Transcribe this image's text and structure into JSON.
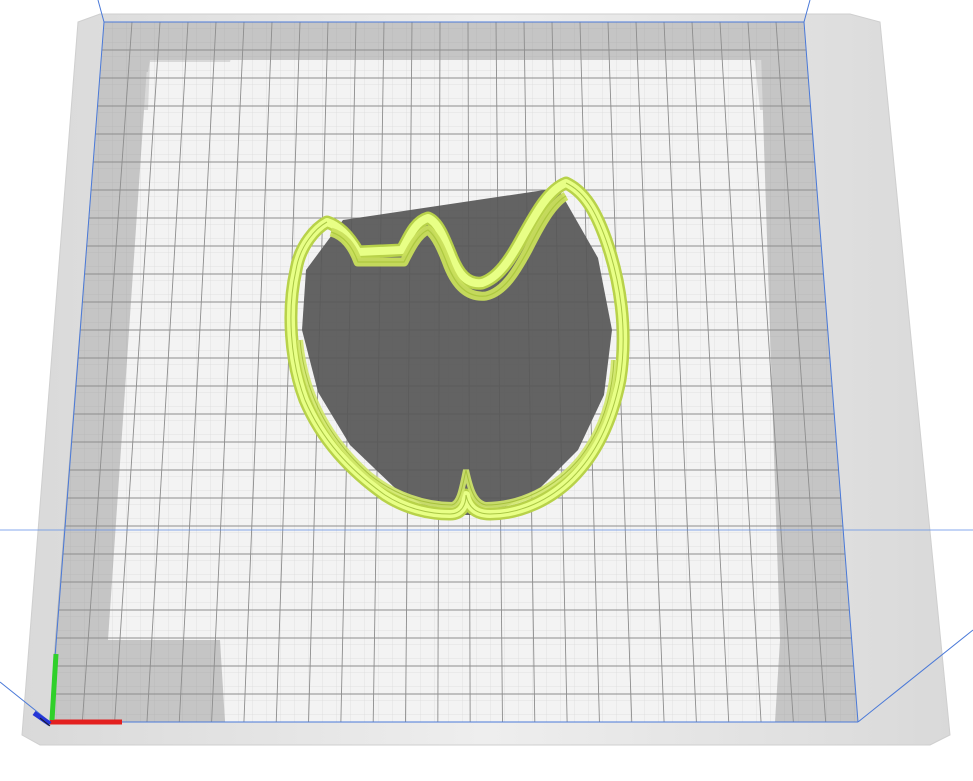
{
  "app": {
    "view": "3d-viewport"
  },
  "scene": {
    "bed_color": "#f3f3f3",
    "bed_frame_color": "#e2e2e2",
    "bed_rim_color": "#d6d6d6",
    "grid_line_color": "#8d8d8d",
    "disallowed_zone_color": "#9a9a9a",
    "build_volume_line_color": "#4a79d8",
    "model_color": "#e5ff7d",
    "model_edge_color": "#9fc22a",
    "model_shadow_color": "#4c4c4c"
  },
  "axes": {
    "x_color": "#e3201f",
    "y_color": "#2fd02a",
    "z_color": "#2636d6"
  },
  "icons": [
    "axis-gizmo-icon"
  ]
}
